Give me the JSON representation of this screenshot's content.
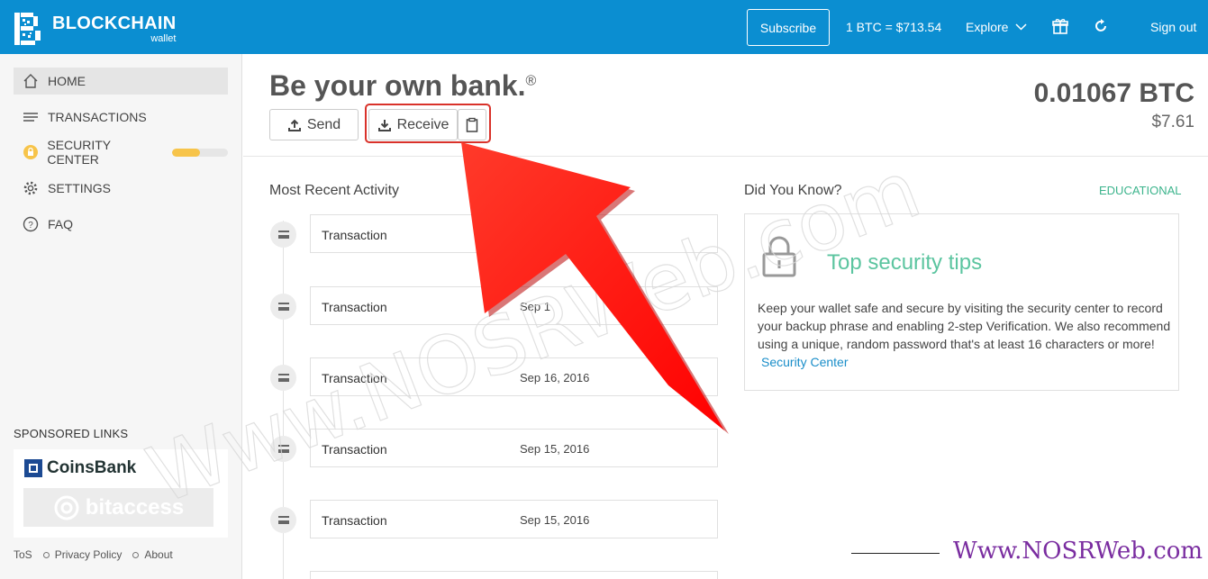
{
  "header": {
    "logo_title": "BLOCKCHAIN",
    "logo_sub": "wallet",
    "subscribe": "Subscribe",
    "price": "1 BTC =  $713.54",
    "explore": "Explore",
    "signout": "Sign out",
    "color": "#0b8ed1"
  },
  "sidebar": {
    "items": [
      {
        "label": "HOME",
        "icon": "home-icon"
      },
      {
        "label": "TRANSACTIONS",
        "icon": "list-icon"
      },
      {
        "label": "SECURITY CENTER",
        "icon": "lock-badge-icon",
        "progress": 0.5
      },
      {
        "label": "SETTINGS",
        "icon": "gear-icon"
      },
      {
        "label": "FAQ",
        "icon": "question-icon"
      }
    ],
    "sponsored_title": "SPONSORED LINKS",
    "sponsors": [
      "CoinsBank",
      "bitaccess"
    ],
    "footer": [
      "ToS",
      "Privacy Policy",
      "About"
    ]
  },
  "main": {
    "headline": "Be your own bank.",
    "headline_mark": "®",
    "send": "Send",
    "receive": "Receive",
    "balance_btc": "0.01067 BTC",
    "balance_usd": "$7.61"
  },
  "activity": {
    "title": "Most Recent Activity",
    "items": [
      {
        "type": "Transaction",
        "date": ""
      },
      {
        "type": "Transaction",
        "date": "Sep 1"
      },
      {
        "type": "Transaction",
        "date": "Sep 16, 2016"
      },
      {
        "type": "Transaction",
        "date": "Sep 15, 2016"
      },
      {
        "type": "Transaction",
        "date": "Sep 15, 2016"
      }
    ]
  },
  "did_you_know": {
    "title": "Did You Know?",
    "tag": "EDUCATIONAL",
    "tip_title": "Top security tips",
    "tip_body": "Keep your wallet safe and secure by visiting the security center to record your backup phrase and enabling 2-step Verification. We also recommend using a unique, random password that's at least 16 characters or more!",
    "tip_link": "Security Center"
  },
  "overlay": {
    "watermark": "Www.NOSRWeb.com",
    "brand": "Www.NOSRWeb.com",
    "arrow_color": "#ff2020"
  }
}
